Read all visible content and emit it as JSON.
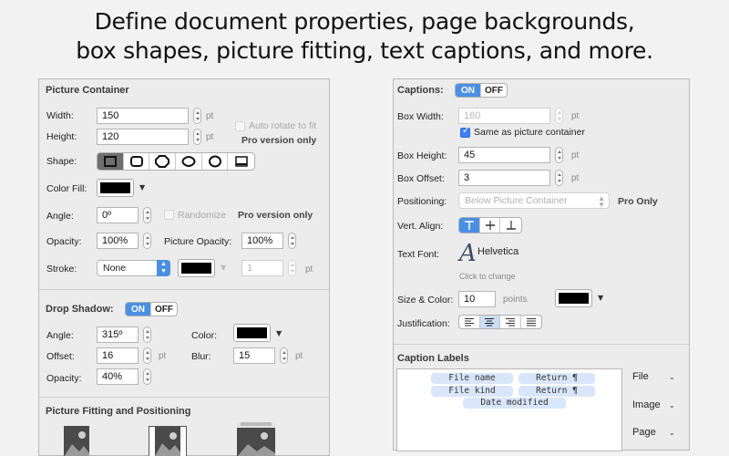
{
  "headline": {
    "line1": "Define document properties, page backgrounds,",
    "line2": "box shapes, picture fitting, text captions, and more."
  },
  "left": {
    "picture_container": {
      "title": "Picture Container",
      "width_label": "Width:",
      "width_value": "150",
      "width_unit": "pt",
      "height_label": "Height:",
      "height_value": "120",
      "height_unit": "pt",
      "auto_rotate_label": "Auto rotate to fit",
      "pro_note": "Pro version only",
      "shape_label": "Shape:",
      "shapes": [
        "square-icon",
        "rounded-square-icon",
        "octagon-icon",
        "wavy-icon",
        "circle-icon",
        "frame-icon"
      ],
      "color_fill_label": "Color Fill:",
      "color_fill_value": "#000000",
      "angle_label": "Angle:",
      "angle_value": "0º",
      "randomize_label": "Randomize",
      "randomize_pro": "Pro version only",
      "opacity_label": "Opacity:",
      "opacity_value": "100%",
      "picture_opacity_label": "Picture Opacity:",
      "picture_opacity_value": "100%",
      "stroke_label": "Stroke:",
      "stroke_value": "None",
      "stroke_width_value": "1",
      "stroke_width_unit": "pt"
    },
    "drop_shadow": {
      "title": "Drop Shadow:",
      "on": "ON",
      "off": "OFF",
      "angle_label": "Angle:",
      "angle_value": "315º",
      "color_label": "Color:",
      "offset_label": "Offset:",
      "offset_value": "16",
      "offset_unit": "pt",
      "blur_label": "Blur:",
      "blur_value": "15",
      "blur_unit": "pt",
      "opacity_label": "Opacity:",
      "opacity_value": "40%"
    },
    "fitting": {
      "title": "Picture Fitting and Positioning"
    }
  },
  "right": {
    "captions": {
      "title": "Captions:",
      "on": "ON",
      "off": "OFF",
      "box_width_label": "Box Width:",
      "box_width_value": "160",
      "box_width_unit": "pt",
      "same_as_label": "Same as picture container",
      "box_height_label": "Box Height:",
      "box_height_value": "45",
      "box_height_unit": "pt",
      "box_offset_label": "Box Offset:",
      "box_offset_value": "3",
      "box_offset_unit": "pt",
      "positioning_label": "Positioning:",
      "positioning_value": "Below Picture Container",
      "pro_only": "Pro Only",
      "vert_align_label": "Vert. Align:",
      "text_font_label": "Text Font:",
      "font_glyph": "A",
      "font_name": "Helvetica",
      "click_to_change": "Click to change",
      "size_color_label": "Size & Color:",
      "size_value": "10",
      "size_unit": "points",
      "justification_label": "Justification:"
    },
    "caption_labels": {
      "title": "Caption Labels",
      "tokens": [
        "File name",
        "Return ¶",
        "File kind",
        "Return ¶",
        "Date modified"
      ],
      "menus": [
        "File",
        "Image",
        "Page"
      ]
    }
  },
  "colors": {
    "accent": "#4a90e2",
    "panel": "#ececec",
    "swatch": "#000000"
  }
}
